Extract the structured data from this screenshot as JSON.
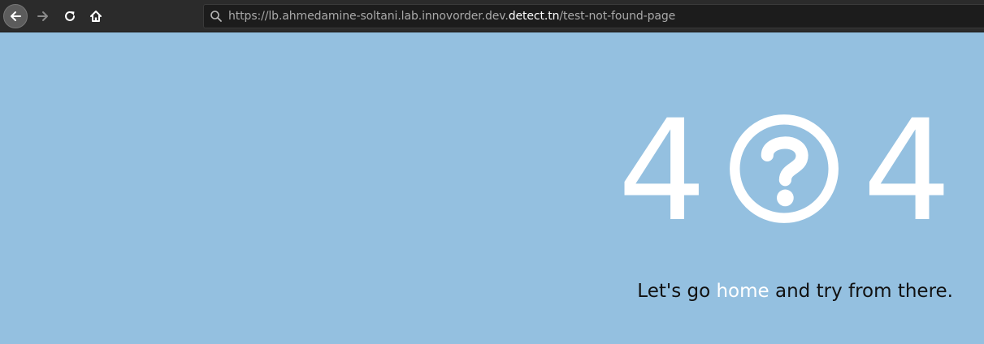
{
  "browser": {
    "url_prefix": "https://lb.ahmedamine-soltani.lab.innovorder.dev.",
    "url_domain": "detect.tn",
    "url_path": "/test-not-found-page"
  },
  "page": {
    "digit_left": "4",
    "digit_right": "4",
    "center_icon": "question-circle-icon",
    "message_before": "Let's go ",
    "home_link": "home",
    "message_after": " and try from there."
  },
  "colors": {
    "page_background": "#94c0e0",
    "toolbar_background": "#2b2b2b",
    "foreground": "#ffffff",
    "message_text": "#111111"
  }
}
